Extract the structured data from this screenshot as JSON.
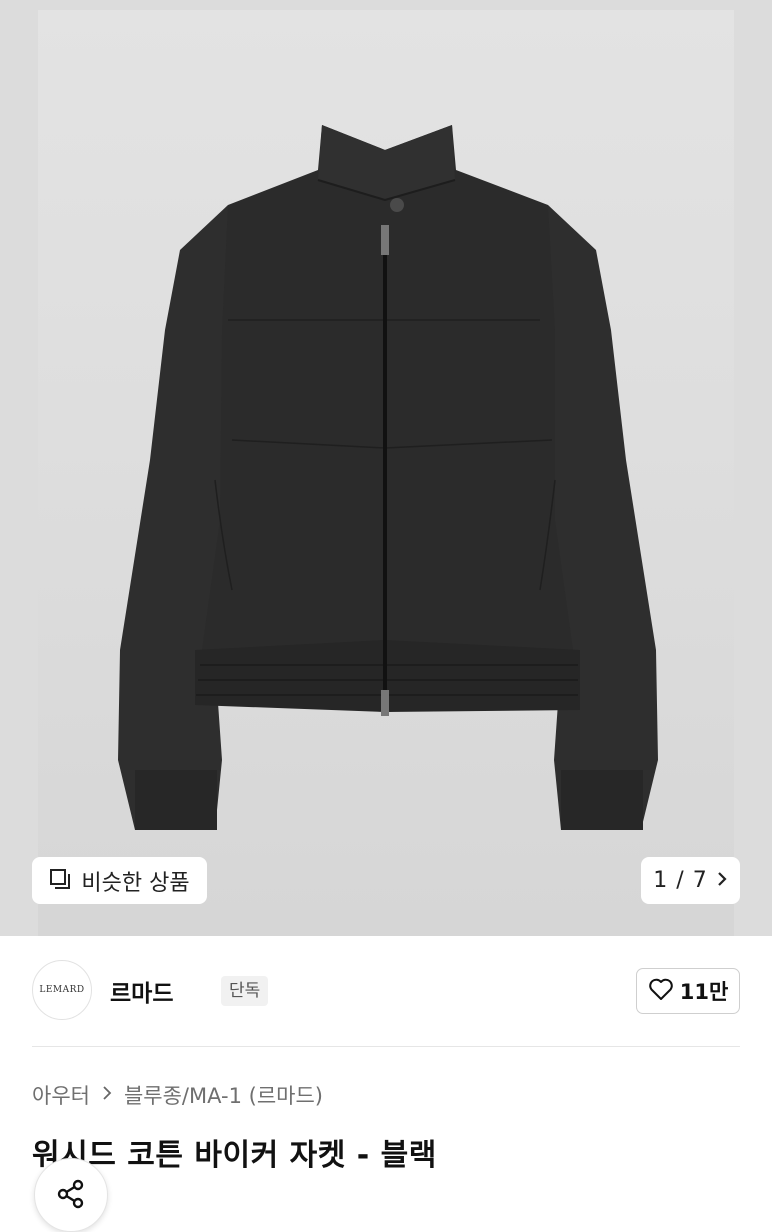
{
  "gallery": {
    "similar_button_label": "비슷한 상품",
    "pager_text": "1 / 7",
    "current_page": 1,
    "total_pages": 7
  },
  "brand": {
    "logo_text": "LEMARD",
    "name": "르마드",
    "tag": "단독",
    "likes": "11만"
  },
  "breadcrumb": [
    "아우터",
    "블루종/MA-1 (르마드)"
  ],
  "product": {
    "title": "워시드 코튼 바이커 자켓 - 블랙"
  },
  "icons": [
    "similar-items-icon",
    "chevron-right-icon",
    "heart-icon",
    "share-icon"
  ],
  "colors": {
    "jacket": "#2b2b2b",
    "photo_background": "#dedede"
  }
}
